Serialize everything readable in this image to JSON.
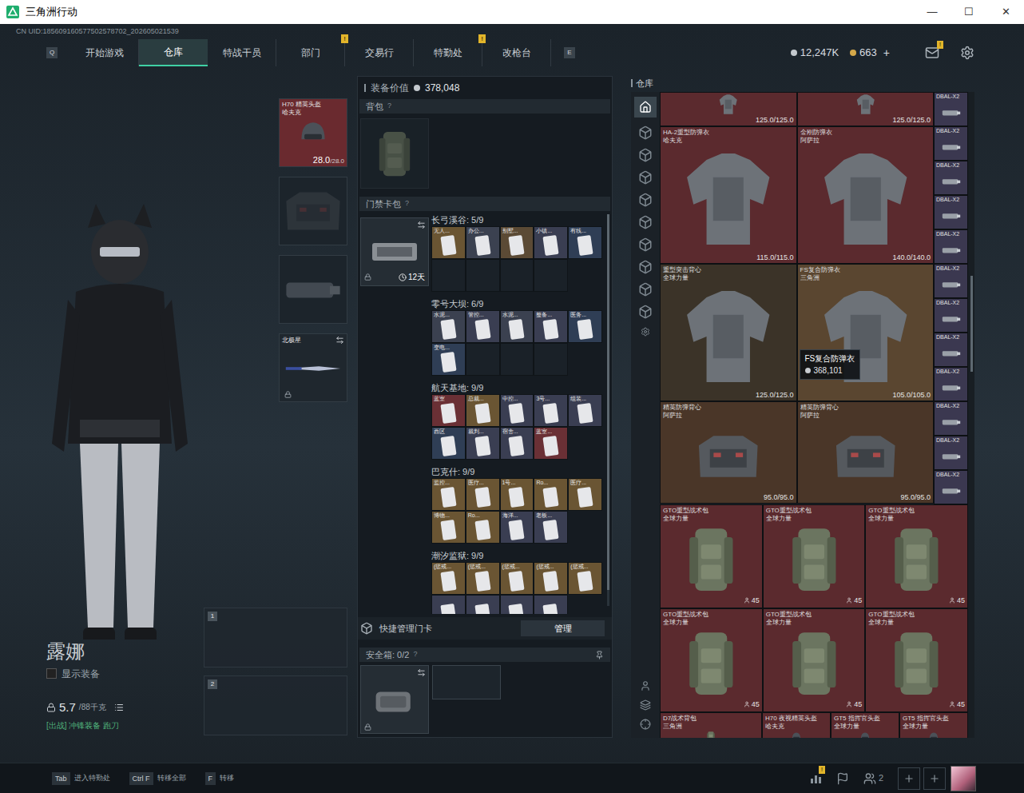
{
  "window": {
    "title": "三角洲行动",
    "controls": [
      "—",
      "☐",
      "✕"
    ]
  },
  "uid": "CN UID:185609160577502578702_202605021539",
  "nav": {
    "left_key": "Q",
    "right_key": "E",
    "tabs": [
      {
        "label": "开始游戏",
        "selected": false,
        "badge": null
      },
      {
        "label": "仓库",
        "selected": true,
        "badge": null
      },
      {
        "label": "特战干员",
        "selected": false,
        "badge": null
      },
      {
        "label": "部门",
        "selected": false,
        "badge": "!"
      },
      {
        "label": "交易行",
        "selected": false,
        "badge": null
      },
      {
        "label": "特勤处",
        "selected": false,
        "badge": "!"
      },
      {
        "label": "改枪台",
        "selected": false,
        "badge": null
      }
    ]
  },
  "currency": [
    {
      "kind": "coin",
      "amount": "12,247K",
      "add": null
    },
    {
      "kind": "gem",
      "amount": "663",
      "add": "+"
    }
  ],
  "mail": {
    "badge": "!"
  },
  "loadout": {
    "slots": [
      {
        "kind": "helmet",
        "filled": true,
        "name": "H70 精英头盔",
        "maker": "哈夫克",
        "durability": "28.0",
        "max": "/28.0",
        "color": "#6a2a2f",
        "swap": false,
        "locked": false
      },
      {
        "kind": "armor",
        "filled": false,
        "name": "",
        "maker": "",
        "durability": "",
        "max": "",
        "color": "#1c242b",
        "swap": false,
        "locked": false
      },
      {
        "kind": "pistol",
        "filled": false,
        "name": "",
        "maker": "",
        "durability": "",
        "max": "",
        "color": "#1c242b",
        "swap": false,
        "locked": false
      },
      {
        "kind": "melee",
        "filled": true,
        "name": "北极星",
        "maker": "",
        "durability": "",
        "max": "",
        "color": "#1f272e",
        "swap": true,
        "locked": true
      }
    ],
    "weapons": [
      {
        "index": "1"
      },
      {
        "index": "2"
      }
    ]
  },
  "character": {
    "name": "露娜",
    "show_gear": {
      "label": "显示装备",
      "checked": false
    },
    "weight": "5.7",
    "weight_max": "/88千克",
    "preset": "[出战] 冲锋装备 跑刀"
  },
  "equipment_value": {
    "label": "装备价值",
    "value": "378,048"
  },
  "backpack": {
    "label": "背包",
    "help": "?"
  },
  "keycard_pack": {
    "label": "门禁卡包",
    "help": "?",
    "days": "12天",
    "groups": [
      {
        "title": "长弓溪谷: 5/9",
        "capacity": 9,
        "cards": [
          {
            "label": "无人...",
            "color": "#6a5533"
          },
          {
            "label": "办公...",
            "color": "#3b4150"
          },
          {
            "label": "别墅...",
            "color": "#5b4a35"
          },
          {
            "label": "小镇...",
            "color": "#3a3e52"
          },
          {
            "label": "有线...",
            "color": "#2f3e55"
          }
        ]
      },
      {
        "title": "零号大坝: 6/9",
        "capacity": 9,
        "cards": [
          {
            "label": "水泥...",
            "color": "#3b4150"
          },
          {
            "label": "管控...",
            "color": "#3a3e52"
          },
          {
            "label": "水泥...",
            "color": "#3b4150"
          },
          {
            "label": "整备...",
            "color": "#3a3e52"
          },
          {
            "label": "医务...",
            "color": "#2f3e55"
          },
          {
            "label": "变电...",
            "color": "#2f3e55"
          }
        ]
      },
      {
        "title": "航天基地: 9/9",
        "capacity": 9,
        "cards": [
          {
            "label": "蓝室",
            "color": "#6a3035"
          },
          {
            "label": "总裁...",
            "color": "#6a5533"
          },
          {
            "label": "中控...",
            "color": "#3a3e52"
          },
          {
            "label": "3号...",
            "color": "#3a3e52"
          },
          {
            "label": "组装...",
            "color": "#3a3e52"
          },
          {
            "label": "西区",
            "color": "#2f3e55"
          },
          {
            "label": "裁判...",
            "color": "#3a3e52"
          },
          {
            "label": "宿舍...",
            "color": "#3a3e52"
          },
          {
            "label": "蓝室...",
            "color": "#6a3035"
          }
        ]
      },
      {
        "title": "巴克什: 9/9",
        "capacity": 9,
        "cards": [
          {
            "label": "监控...",
            "color": "#6a5533"
          },
          {
            "label": "医疗...",
            "color": "#6a5533"
          },
          {
            "label": "1号...",
            "color": "#6a5533"
          },
          {
            "label": "Ro...",
            "color": "#6a5533"
          },
          {
            "label": "医疗...",
            "color": "#6a5533"
          },
          {
            "label": "博物...",
            "color": "#6a5533"
          },
          {
            "label": "Ro...",
            "color": "#6a5533"
          },
          {
            "label": "海洋...",
            "color": "#3a3e52"
          },
          {
            "label": "老板...",
            "color": "#3a3e52"
          }
        ]
      },
      {
        "title": "潮汐监狱: 9/9",
        "capacity": 9,
        "cards": [
          {
            "label": "(惩戒...",
            "color": "#6a5533"
          },
          {
            "label": "(惩戒...",
            "color": "#6a5533"
          },
          {
            "label": "(惩戒...",
            "color": "#6a5533"
          },
          {
            "label": "(惩戒...",
            "color": "#6a5533"
          },
          {
            "label": "(惩戒...",
            "color": "#6a5533"
          },
          {
            "label": "",
            "color": "#3a3e52"
          },
          {
            "label": "",
            "color": "#3a3e52"
          },
          {
            "label": "",
            "color": "#3a3e52"
          },
          {
            "label": "",
            "color": "#3a3e52"
          }
        ]
      }
    ]
  },
  "quick_manage": {
    "label": "快捷管理门卡",
    "button": "管理"
  },
  "safe_box": {
    "label": "安全箱: 0/2",
    "help": "?"
  },
  "warehouse": {
    "title": "仓库",
    "top_partial": [
      {
        "kind": "armor",
        "durability": "125.0/125.0",
        "color": "#5b2a2e"
      },
      {
        "kind": "armor",
        "durability": "125.0/125.0",
        "color": "#5b2a2e"
      }
    ],
    "armor_rows": [
      [
        {
          "kind": "armor",
          "name": "HA-2重型防弹衣",
          "maker": "哈夫克",
          "durability": "115.0/115.0",
          "color": "#5b2a2e"
        },
        {
          "kind": "armor",
          "name": "金刚防弹衣",
          "maker": "阿萨拉",
          "durability": "140.0/140.0",
          "color": "#5b2a2e"
        }
      ],
      [
        {
          "kind": "armor",
          "name": "重型突击背心",
          "maker": "全球力量",
          "durability": "125.0/125.0",
          "color": "#3b3328"
        },
        {
          "kind": "armor",
          "name": "FS复合防弹衣",
          "maker": "三角洲",
          "durability": "105.0/105.0",
          "color": "#5a4630"
        }
      ]
    ],
    "vests": [
      {
        "kind": "vest",
        "name": "精英防弹背心",
        "maker": "阿萨拉",
        "durability": "95.0/95.0",
        "color": "#4a3628"
      },
      {
        "kind": "vest",
        "name": "精英防弹背心",
        "maker": "阿萨拉",
        "durability": "95.0/95.0",
        "color": "#4a3628"
      }
    ],
    "side_items": [
      {
        "name": "DBAL-X2"
      },
      {
        "name": "DBAL-X2"
      },
      {
        "name": "DBAL-X2"
      },
      {
        "name": "DBAL-X2"
      },
      {
        "name": "DBAL-X2"
      },
      {
        "name": "DBAL-X2"
      },
      {
        "name": "DBAL-X2"
      },
      {
        "name": "DBAL-X2"
      },
      {
        "name": "DBAL-X2"
      },
      {
        "name": "DBAL-X2"
      },
      {
        "name": "DBAL-X2"
      },
      {
        "name": "DBAL-X2"
      }
    ],
    "bags": [
      {
        "kind": "bag",
        "name": "GTO重型战术包",
        "maker": "全球力量",
        "capacity": "45",
        "color": "#5b2a2e"
      },
      {
        "kind": "bag",
        "name": "GTO重型战术包",
        "maker": "全球力量",
        "capacity": "45",
        "color": "#5b2a2e"
      },
      {
        "kind": "bag",
        "name": "GTO重型战术包",
        "maker": "全球力量",
        "capacity": "45",
        "color": "#5b2a2e"
      },
      {
        "kind": "bag",
        "name": "GTO重型战术包",
        "maker": "全球力量",
        "capacity": "45",
        "color": "#5b2a2e"
      },
      {
        "kind": "bag",
        "name": "GTO重型战术包",
        "maker": "全球力量",
        "capacity": "45",
        "color": "#5b2a2e"
      },
      {
        "kind": "bag",
        "name": "GTO重型战术包",
        "maker": "全球力量",
        "capacity": "45",
        "color": "#5b2a2e"
      }
    ],
    "bottom_row": [
      {
        "kind": "bag",
        "name": "D7战术背包",
        "maker": "三角洲",
        "color": "#5b2a2e"
      },
      {
        "kind": "helmet",
        "name": "H70 夜视精英头盔",
        "maker": "哈夫克",
        "color": "#5b2a2e"
      },
      {
        "kind": "helmet",
        "name": "GT5 指挥官头盔",
        "maker": "全球力量",
        "color": "#5b2a2e"
      },
      {
        "kind": "helmet",
        "name": "GT5 指挥官头盔",
        "maker": "全球力量",
        "color": "#5b2a2e"
      }
    ],
    "tooltip": {
      "name": "FS复合防弹衣",
      "price": "368,101"
    }
  },
  "bottom_bar": {
    "hints": [
      {
        "key": "Tab",
        "label": "进入特勤处"
      },
      {
        "key": "Ctrl F",
        "label": "转移全部"
      },
      {
        "key": "F",
        "label": "转移"
      }
    ],
    "alert": "!",
    "friends": "2"
  }
}
